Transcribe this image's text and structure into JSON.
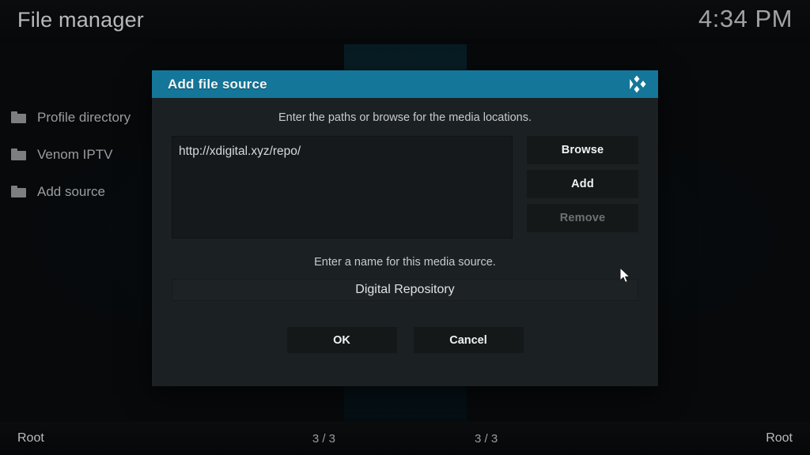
{
  "window": {
    "title": "File manager",
    "clock": "4:34 PM"
  },
  "sidebar": {
    "items": [
      {
        "label": "Profile directory",
        "icon": "folder-icon"
      },
      {
        "label": "Venom IPTV",
        "icon": "folder-icon"
      },
      {
        "label": "Add source",
        "icon": "folder-icon"
      }
    ]
  },
  "dialog": {
    "title": "Add file source",
    "logo_icon": "kodi-logo-icon",
    "paths_hint": "Enter the paths or browse for the media locations.",
    "paths": [
      "http://xdigital.xyz/repo/"
    ],
    "side_buttons": [
      {
        "label": "Browse",
        "disabled": false
      },
      {
        "label": "Add",
        "disabled": false
      },
      {
        "label": "Remove",
        "disabled": true
      }
    ],
    "name_hint": "Enter a name for this media source.",
    "name_value": "Digital Repository",
    "ok_label": "OK",
    "cancel_label": "Cancel"
  },
  "statusbar": {
    "left": {
      "path": "Root",
      "count": "3 / 3"
    },
    "right": {
      "count": "3 / 3",
      "path": "Root"
    }
  },
  "colors": {
    "header_teal": "#147699",
    "dialog_bg": "#1b2023",
    "button_bg": "#141819",
    "text_primary": "#f0f3f4",
    "text_muted": "#6d7173"
  },
  "cursor": {
    "icon": "arrow-cursor-icon"
  }
}
